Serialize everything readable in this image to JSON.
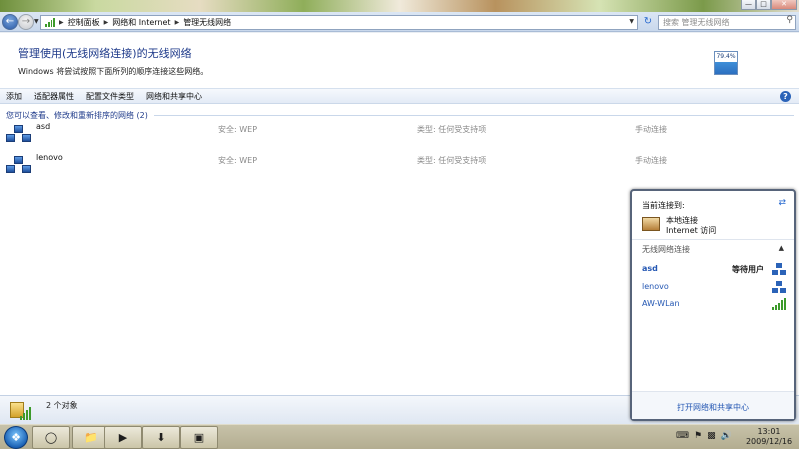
{
  "window": {
    "controls": {
      "minimize": "—",
      "maximize": "□",
      "close": "✕"
    }
  },
  "navbar": {
    "breadcrumbs": [
      "控制面板",
      "网络和 Internet",
      "管理无线网络"
    ],
    "search_placeholder": "搜索 管理无线网络"
  },
  "page": {
    "title": "管理使用(无线网络连接)的无线网络",
    "description": "Windows 将尝试按照下面所列的顺序连接这些网络。",
    "signal_badge": "79.4%"
  },
  "toolbar": {
    "items": [
      "添加",
      "适配器属性",
      "配置文件类型",
      "网络和共享中心"
    ]
  },
  "networks": {
    "group_label": "您可以查看、修改和重新排序的网络 (2)",
    "items": [
      {
        "name": "asd",
        "security": "安全: WEP",
        "type": "类型: 任何受支持项",
        "mode": "手动连接"
      },
      {
        "name": "lenovo",
        "security": "安全: WEP",
        "type": "类型: 任何受支持项",
        "mode": "手动连接"
      }
    ]
  },
  "statusbar": {
    "text": "2 个对象"
  },
  "popup": {
    "header": "当前连接到:",
    "connection_name": "本地连接",
    "connection_sub": "Internet 访问",
    "section_label": "无线网络连接",
    "items": [
      {
        "name": "asd",
        "status": "等待用户"
      },
      {
        "name": "lenovo",
        "status": ""
      },
      {
        "name": "AW-WLan",
        "status": ""
      }
    ],
    "footer_link": "打开网络和共享中心"
  },
  "taskbar": {
    "time": "13:01",
    "date": "2009/12/16"
  },
  "colors": {
    "title_blue": "#1e3a8a",
    "link_blue": "#2457b3",
    "signal_green": "#3c9a2a"
  }
}
